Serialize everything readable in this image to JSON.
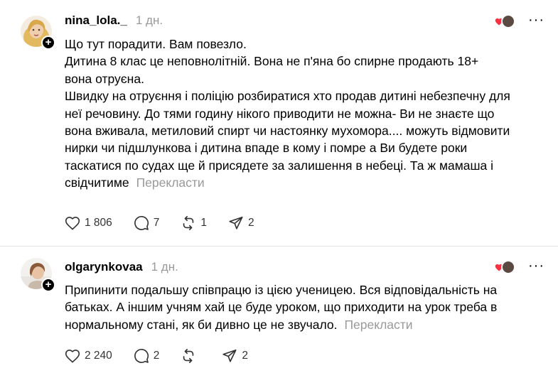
{
  "posts": [
    {
      "username": "nina_lola._",
      "time": "1 дн.",
      "more_label": "···",
      "lines": [
        "Що тут порадити. Вам повезло.",
        "Дитина 8 клас це неповнолітній. Вона не п'яна бо спирне продають 18+",
        "вона отруєна.",
        "Швидку на отруєння і поліцію розбиратися хто продав дитині небезпечну для",
        "неї речовину. До тями годину нікого приводити не можна- Ви не знаєте що",
        "вона вживала, метиловий спирт чи настоянку мухомора.... можуть відмовити",
        "нирки чи підшлункова і дитина впаде в кому і помре а Ви будете роки",
        "таскатися по судах ще й присядете за залишення в небеці. Та ж мамаша і",
        "свідчитиме"
      ],
      "translate_label": "Перекласти",
      "likes": "1 806",
      "replies": "7",
      "reposts": "1",
      "shares": "2"
    },
    {
      "username": "olgarynkovaa",
      "time": "1 дн.",
      "more_label": "···",
      "lines": [
        "Припинити подальшу співпрацю із цією ученицею. Вся відповідальність на",
        "батьках. А іншим учням хай це буде уроком, що приходити на урок треба в",
        "нормальному стані, як би дивно це не звучало."
      ],
      "translate_label": "Перекласти",
      "likes": "2 240",
      "replies": "2",
      "reposts": "",
      "shares": "2"
    }
  ],
  "icons": {
    "follow": "plus-icon",
    "like": "heart-icon",
    "reply": "comment-icon",
    "repost": "repost-icon",
    "share": "send-icon",
    "reaction": "red-heart-icon"
  },
  "colors": {
    "muted": "#999999",
    "heart": "#ff3040",
    "divider": "#e4e4e4"
  }
}
